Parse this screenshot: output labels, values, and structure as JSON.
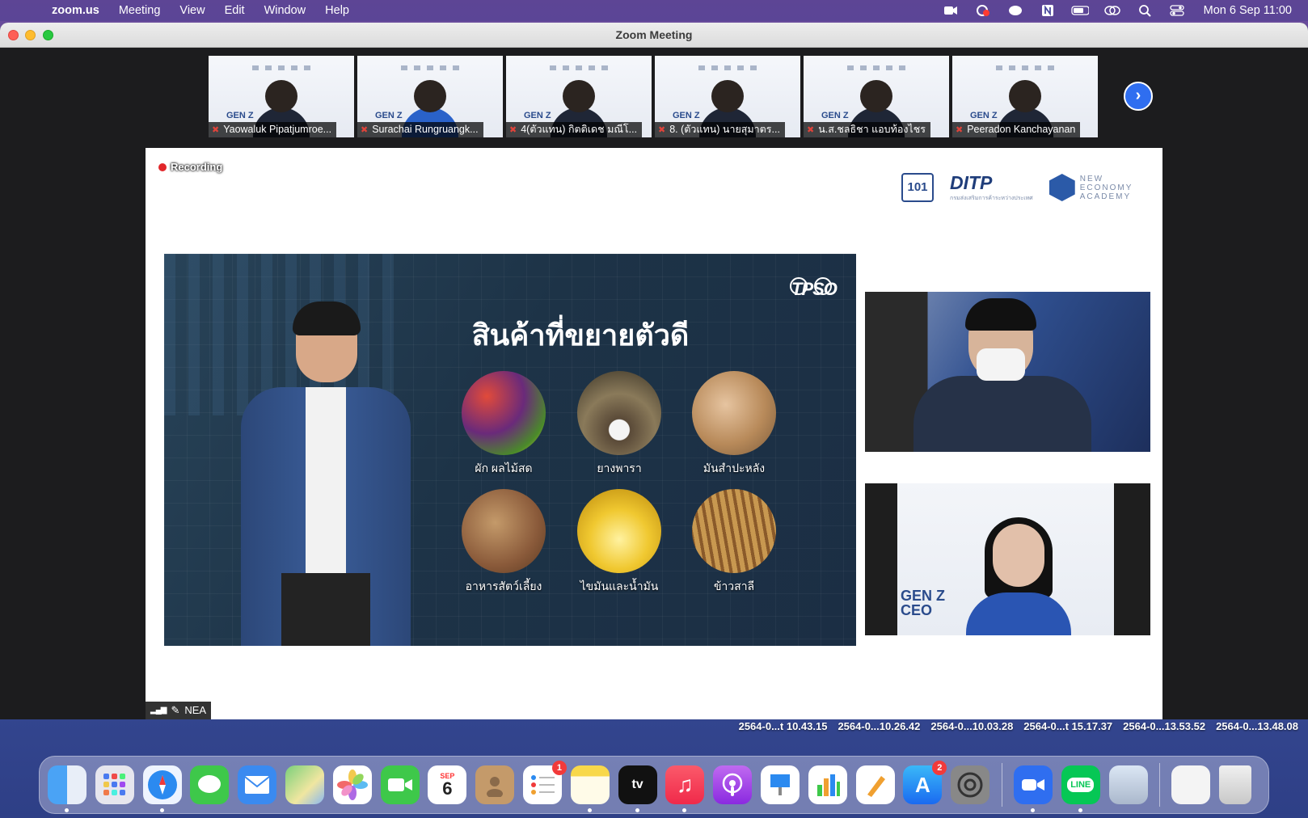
{
  "menubar": {
    "app_name": "zoom.us",
    "items": [
      "Meeting",
      "View",
      "Edit",
      "Window",
      "Help"
    ],
    "status_icons": [
      "zoom-status-icon",
      "recording-status-icon",
      "line-status-icon",
      "notion-status-icon",
      "battery-icon",
      "screen-mirror-icon",
      "spotlight-search-icon",
      "control-center-icon"
    ],
    "clock": "Mon 6 Sep  11:00"
  },
  "window": {
    "title": "Zoom Meeting"
  },
  "participants": [
    {
      "name": "Yaowaluk Pipatjumroe...",
      "muted": true
    },
    {
      "name": "Surachai Rungruangk...",
      "muted": true
    },
    {
      "name": "4(ตัวแทน) กิตติเดช มณีโ...",
      "muted": true
    },
    {
      "name": "8. (ตัวแทน) นายสุมาตร...",
      "muted": true
    },
    {
      "name": "น.ส.ชลธิชา แอบท้องไชร",
      "muted": true
    },
    {
      "name": "Peeradon Kanchayanan",
      "muted": true
    }
  ],
  "share": {
    "recording_label": "Recording",
    "logos": {
      "ditp": "DITP",
      "nea": "NEW\nECONOMY\nACADEMY"
    },
    "slide": {
      "brand": "TPSO",
      "title": "สินค้าที่ขยายตัวดี",
      "products": [
        {
          "label": "ผัก ผลไม้สด"
        },
        {
          "label": "ยางพารา"
        },
        {
          "label": "มันสำปะหลัง"
        },
        {
          "label": "อาหารสัตว์เลี้ยง"
        },
        {
          "label": "ไขมันและน้ำมัน"
        },
        {
          "label": "ข้าวสาลี"
        }
      ]
    },
    "video2_text": "GEN Z\nCEO",
    "presenter_tag": "NEA"
  },
  "desktop_files": [
    "2564-0...t 10.43.15",
    "2564-0...10.26.42",
    "2564-0...10.03.28",
    "2564-0...t 15.17.37",
    "2564-0...13.53.52",
    "2564-0...13.48.08"
  ],
  "dock": {
    "calendar": {
      "month": "SEP",
      "day": "6"
    },
    "badges": {
      "reminders": "1",
      "app_store": "2"
    },
    "apps": [
      "Finder",
      "Launchpad",
      "Safari",
      "Messages",
      "Mail",
      "Maps",
      "Photos",
      "FaceTime",
      "Calendar",
      "Contacts",
      "Reminders",
      "Notes",
      "TV",
      "Music",
      "Podcasts",
      "Keynote",
      "Numbers",
      "Pages",
      "App Store",
      "System Preferences",
      "Zoom",
      "LINE",
      "Preview",
      "Downloads",
      "Trash"
    ]
  },
  "colors": {
    "zoom_blue": "#2f6ef0",
    "recording_red": "#e1262a",
    "mute_red": "#e0433a"
  }
}
